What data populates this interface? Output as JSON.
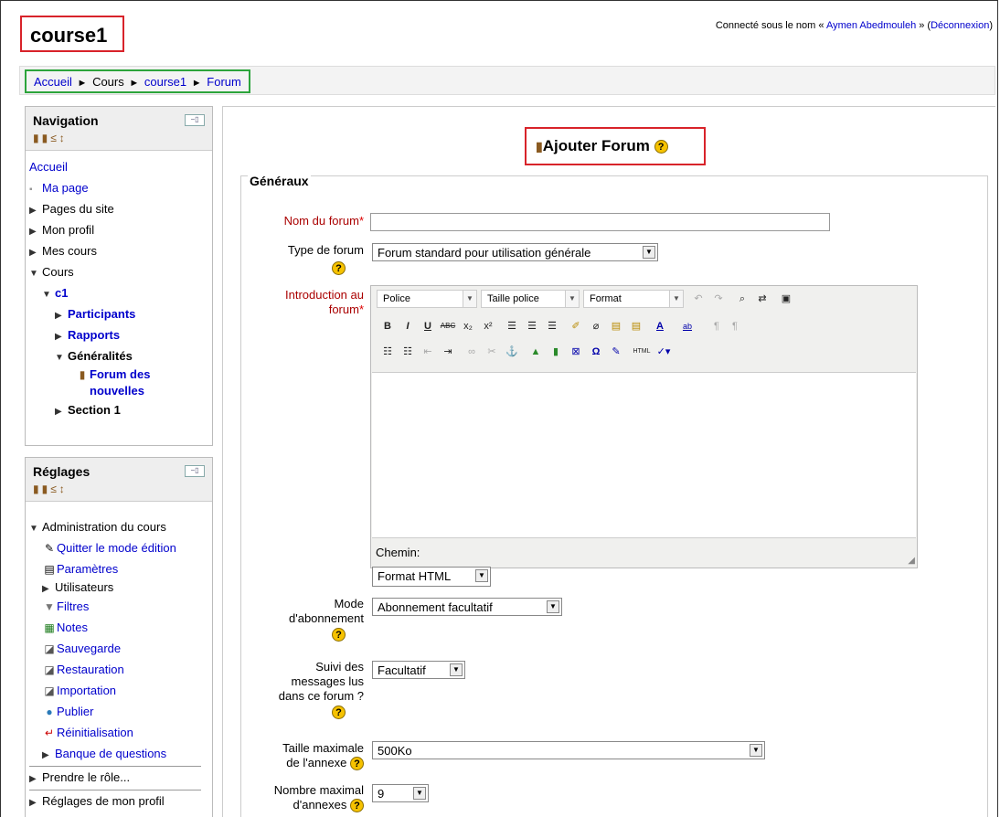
{
  "header": {
    "course_title": "course1",
    "login_prefix": "Connecté sous le nom « ",
    "user_name": "Aymen Abedmouleh",
    "login_mid": " » (",
    "logout": "Déconnexion",
    "login_suffix": ")"
  },
  "breadcrumb": {
    "items": [
      "Accueil",
      "Cours",
      "course1",
      "Forum"
    ],
    "separator": "►"
  },
  "navigation": {
    "title": "Navigation",
    "home": "Accueil",
    "items": [
      {
        "label": "Ma page"
      },
      {
        "label": "Pages du site"
      },
      {
        "label": "Mon profil"
      },
      {
        "label": "Mes cours"
      },
      {
        "label": "Cours"
      },
      {
        "label": "c1"
      },
      {
        "label": "Participants"
      },
      {
        "label": "Rapports"
      },
      {
        "label": "Généralités"
      },
      {
        "label": "Forum des"
      },
      {
        "label": "nouvelles"
      },
      {
        "label": "Section 1"
      }
    ]
  },
  "settings": {
    "title": "Réglages",
    "items": [
      {
        "label": "Administration du cours"
      },
      {
        "label": "Quitter le mode édition"
      },
      {
        "label": "Paramètres"
      },
      {
        "label": "Utilisateurs"
      },
      {
        "label": "Filtres"
      },
      {
        "label": "Notes"
      },
      {
        "label": "Sauvegarde"
      },
      {
        "label": "Restauration"
      },
      {
        "label": "Importation"
      },
      {
        "label": "Publier"
      },
      {
        "label": "Réinitialisation"
      },
      {
        "label": "Banque de questions"
      },
      {
        "label": "Prendre le rôle..."
      },
      {
        "label": "Réglages de mon profil"
      }
    ]
  },
  "main": {
    "heading": "Ajouter Forum",
    "help_glyph": "?",
    "section": "Généraux",
    "fields": {
      "name_label": "Nom du forum",
      "required_mark": "*",
      "type_label": "Type de forum",
      "type_value": "Forum standard pour utilisation générale",
      "intro_label_1": "Introduction au",
      "intro_label_2": "forum",
      "format_value": "Format HTML",
      "sub_label_1": "Mode",
      "sub_label_2": "d'abonnement",
      "sub_value": "Abonnement facultatif",
      "track_label_1": "Suivi des",
      "track_label_2": "messages lus",
      "track_label_3": "dans ce forum ?",
      "track_value": "Facultatif",
      "maxsize_label_1": "Taille maximale",
      "maxsize_label_2": "de l'annexe",
      "maxsize_value": "500Ko",
      "maxatt_label_1": "Nombre maximal",
      "maxatt_label_2": "d'annexes",
      "maxatt_value": "9"
    },
    "editor": {
      "font_select": "Police",
      "size_select": "Taille police",
      "format_select": "Format",
      "path_label": "Chemin:"
    }
  }
}
